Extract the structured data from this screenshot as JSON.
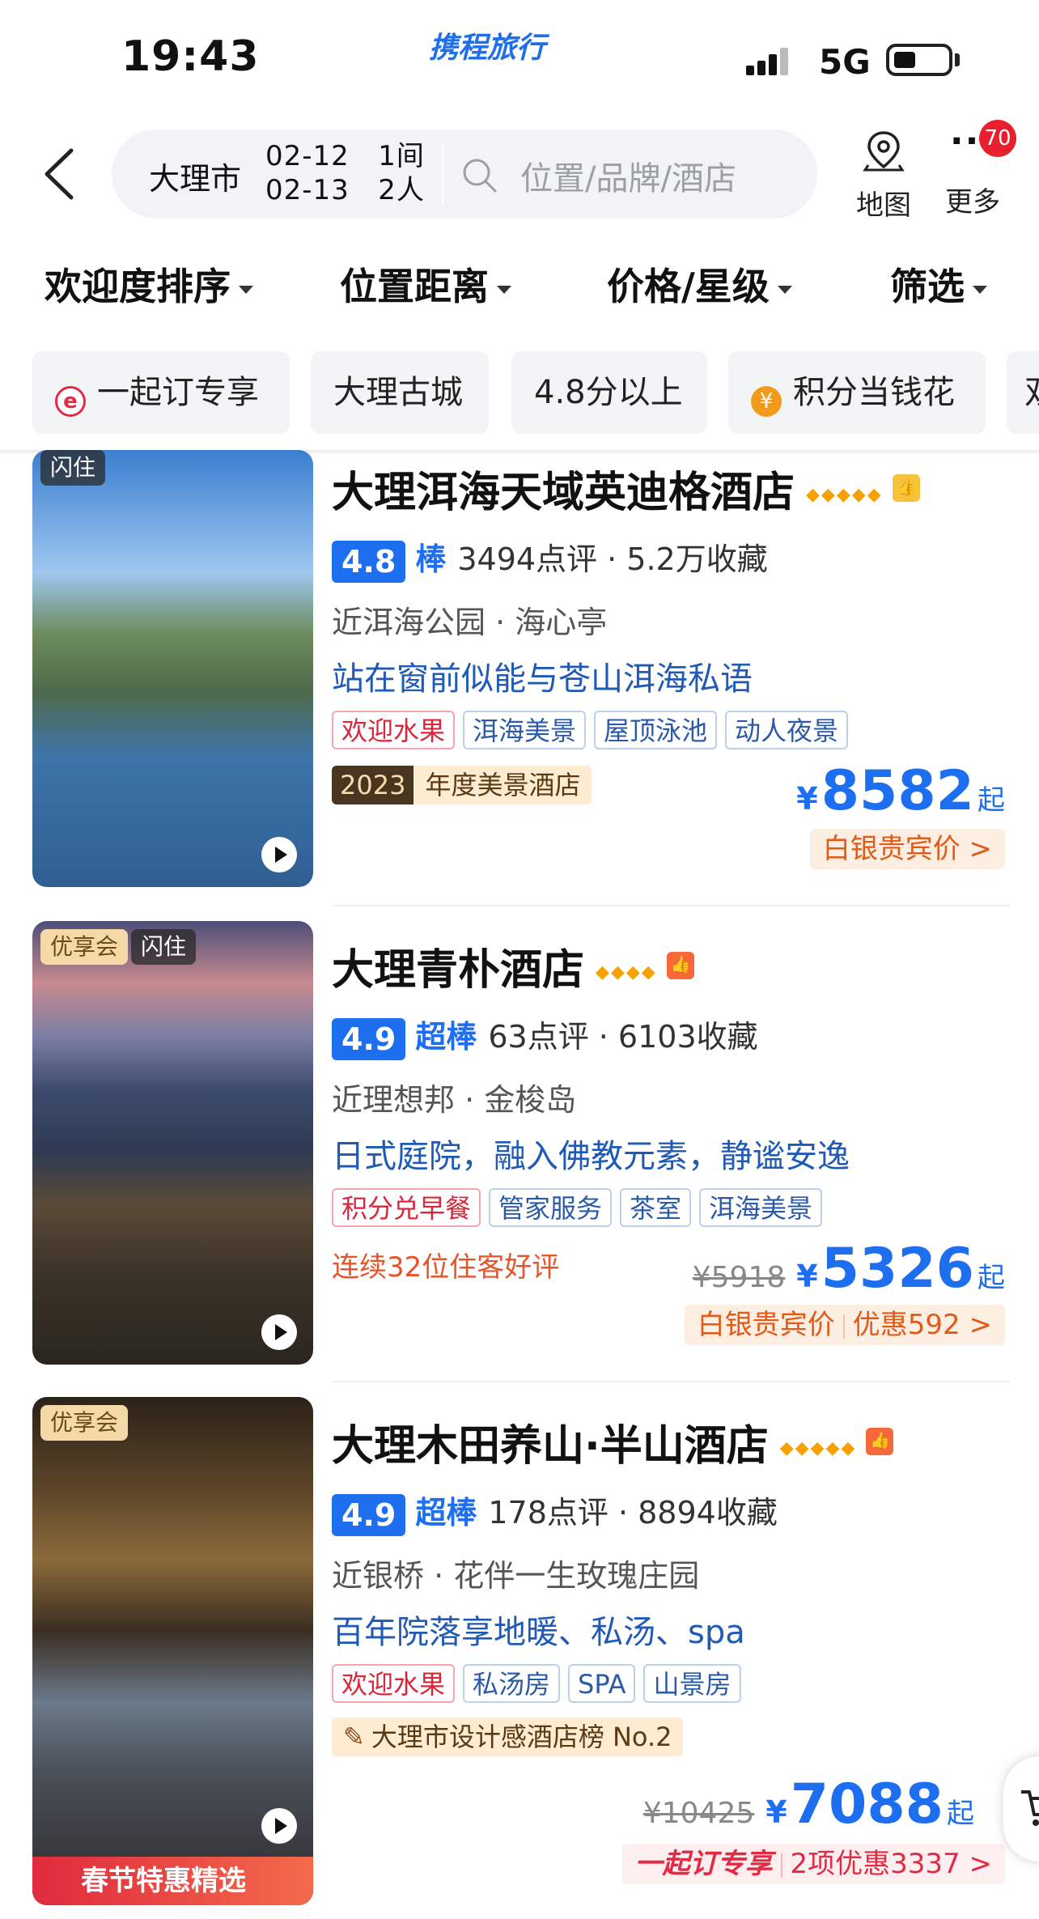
{
  "status": {
    "time": "19:43",
    "brand": "携程旅行",
    "network": "5G"
  },
  "header": {
    "city": "大理市",
    "checkin": "02-12",
    "checkout": "02-13",
    "rooms": "1间",
    "guests": "2人",
    "search_placeholder": "位置/品牌/酒店",
    "map_label": "地图",
    "more_label": "更多",
    "more_badge": "70"
  },
  "sort": {
    "popularity": "欢迎度排序",
    "location": "位置距离",
    "price_star": "价格/星级",
    "filter": "筛选"
  },
  "chips": [
    "一起订专享",
    "大理古城",
    "4.8分以上",
    "积分当钱花",
    "双"
  ],
  "hotels": [
    {
      "name": "大理洱海天域英迪格酒店",
      "stars": "◆◆◆◆◆",
      "img_tags": [
        "闪住"
      ],
      "score": "4.8",
      "grade": "棒",
      "stats": "3494点评 · 5.2万收藏",
      "location": "近洱海公园 · 海心亭",
      "slogan": "站在窗前似能与苍山洱海私语",
      "tags": [
        "欢迎水果",
        "洱海美景",
        "屋顶泳池",
        "动人夜景"
      ],
      "award_year": "2023",
      "award": "年度美景酒店",
      "currency": "¥",
      "price": "8582",
      "qi": "起",
      "member": "白银贵宾价 >"
    },
    {
      "name": "大理青朴酒店",
      "stars": "◆◆◆◆",
      "img_tags": [
        "优享会",
        "闪住"
      ],
      "score": "4.9",
      "grade": "超棒",
      "stats": "63点评 · 6103收藏",
      "location": "近理想邦 · 金梭岛",
      "slogan": "日式庭院，融入佛教元素，静谧安逸",
      "tags": [
        "积分兑早餐",
        "管家服务",
        "茶室",
        "洱海美景"
      ],
      "streak": "连续32位住客好评",
      "orig_price": "¥5918",
      "currency": "¥",
      "price": "5326",
      "qi": "起",
      "member": "白银贵宾价",
      "discount": "优惠592 >"
    },
    {
      "name": "大理木田养山·半山酒店",
      "stars": "◆◆◆◆◆",
      "img_tags": [
        "优享会"
      ],
      "score": "4.9",
      "grade": "超棒",
      "stats": "178点评 · 8894收藏",
      "location": "近银桥 · 花伴一生玫瑰庄园",
      "slogan": "百年院落享地暖、私汤、spa",
      "tags": [
        "欢迎水果",
        "私汤房",
        "SPA",
        "山景房"
      ],
      "award": "大理市设计感酒店榜 No.2",
      "banner": "春节特惠精选",
      "orig_price": "¥10425",
      "currency": "¥",
      "price": "7088",
      "qi": "起",
      "together": "一起订专享",
      "discount": "2项优惠3337 >"
    }
  ],
  "colors": {
    "accent": "#1e6ef0",
    "orange": "#e25a18",
    "red": "#d8273a"
  }
}
